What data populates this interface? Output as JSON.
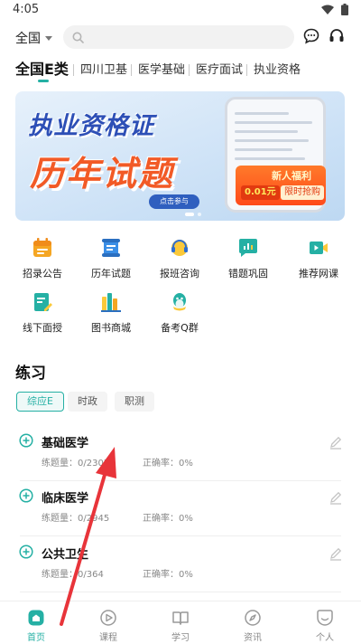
{
  "status_bar": {
    "time": "4:05"
  },
  "header": {
    "region": "全国",
    "search_placeholder": ""
  },
  "category_tabs": [
    "全国E类",
    "四川卫基",
    "医学基础",
    "医疗面试",
    "执业资格"
  ],
  "banner": {
    "title_line1": "执业资格证",
    "title_line2": "历年试题",
    "cta": "点击参与",
    "promo_title": "新人福利",
    "promo_price": "0.01元",
    "promo_tag": "限时抢购"
  },
  "grid": [
    {
      "label": "招录公告",
      "icon": "calendar-icon",
      "color": "#f5a623"
    },
    {
      "label": "历年试题",
      "icon": "scroll-icon",
      "color": "#3a8ee6"
    },
    {
      "label": "报班咨询",
      "icon": "headset-icon",
      "color": "#f5b623"
    },
    {
      "label": "错题巩固",
      "icon": "chat-chart-icon",
      "color": "#25b0a4"
    },
    {
      "label": "推荐网课",
      "icon": "video-icon",
      "color": "#25b0a4"
    },
    {
      "label": "线下面授",
      "icon": "edit-note-icon",
      "color": "#25b0a4"
    },
    {
      "label": "图书商城",
      "icon": "books-icon",
      "color": "#f5a623"
    },
    {
      "label": "备考Q群",
      "icon": "qq-penguin-icon",
      "color": "#25b0a4"
    }
  ],
  "practice": {
    "title": "练习",
    "chips": [
      "综应E",
      "时政",
      "职测"
    ],
    "subjects": [
      {
        "name": "基础医学",
        "count": "练题量：0/2307",
        "rate": "正确率：0%"
      },
      {
        "name": "临床医学",
        "count": "练题量：0/2945",
        "rate": "正确率：0%"
      },
      {
        "name": "公共卫生",
        "count": "练题量：0/364",
        "rate": "正确率：0%"
      }
    ]
  },
  "bottom_nav": [
    "首页",
    "课程",
    "学习",
    "资讯",
    "个人"
  ],
  "colors": {
    "accent": "#25b0a4",
    "annotation_arrow": "#e8343a"
  }
}
